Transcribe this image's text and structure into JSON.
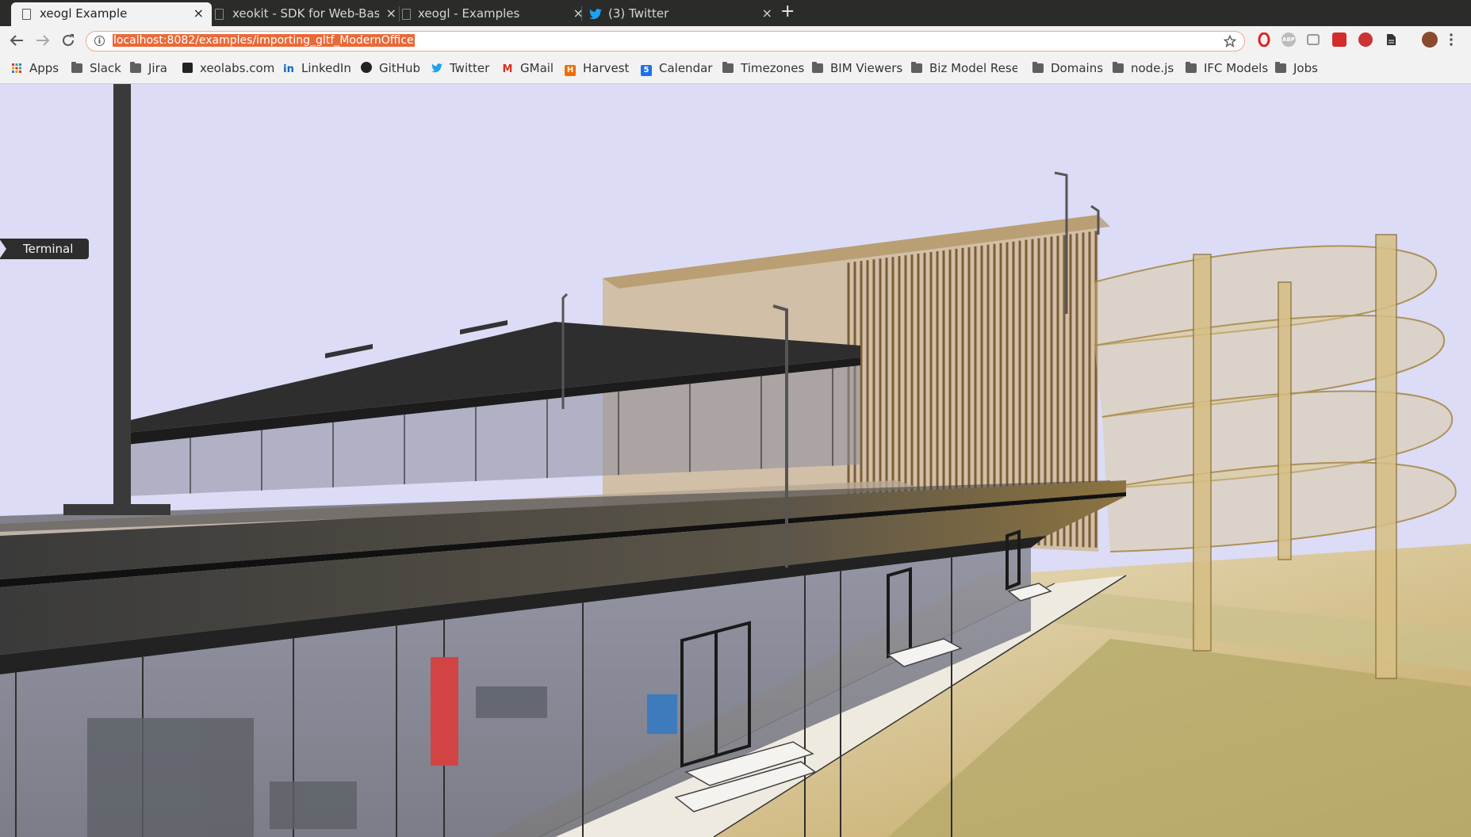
{
  "browser": {
    "tabs": [
      {
        "title": "xeogl Example",
        "active": true,
        "icon": "page-icon"
      },
      {
        "title": "xeokit - SDK for Web-Based",
        "active": false,
        "icon": "page-icon"
      },
      {
        "title": "xeogl - Examples",
        "active": false,
        "icon": "page-icon"
      },
      {
        "title": "(3) Twitter",
        "active": false,
        "icon": "twitter-icon"
      }
    ],
    "new_tab_label": "+",
    "close_glyph": "×",
    "url": "localhost:8082/examples/importing_gltf_ModernOffice",
    "info_glyph": "i"
  },
  "bookmarks": [
    {
      "label": "Apps",
      "icon": "apps-grid-icon"
    },
    {
      "label": "Slack",
      "icon": "folder-icon"
    },
    {
      "label": "Jira",
      "icon": "folder-icon"
    },
    {
      "label": "xeolabs.com",
      "icon": "xeolabs-icon"
    },
    {
      "label": "LinkedIn",
      "icon": "linkedin-icon"
    },
    {
      "label": "GitHub",
      "icon": "github-icon"
    },
    {
      "label": "Twitter",
      "icon": "twitter-icon"
    },
    {
      "label": "GMail",
      "icon": "gmail-icon"
    },
    {
      "label": "Harvest",
      "icon": "harvest-icon"
    },
    {
      "label": "Calendar",
      "icon": "calendar-icon"
    },
    {
      "label": "Timezones",
      "icon": "folder-icon"
    },
    {
      "label": "BIM Viewers",
      "icon": "folder-icon"
    },
    {
      "label": "Biz Model Resea",
      "icon": "folder-icon"
    },
    {
      "label": "Domains",
      "icon": "folder-icon"
    },
    {
      "label": "node.js",
      "icon": "folder-icon"
    },
    {
      "label": "IFC Models",
      "icon": "folder-icon"
    },
    {
      "label": "Jobs",
      "icon": "folder-icon"
    }
  ],
  "viewer": {
    "terminal_label": "Terminal"
  },
  "colors": {
    "sky": "#dcdcf6",
    "url_highlight": "#e96a39",
    "roof": "#2a2a2a",
    "wood": "#c9a868"
  }
}
